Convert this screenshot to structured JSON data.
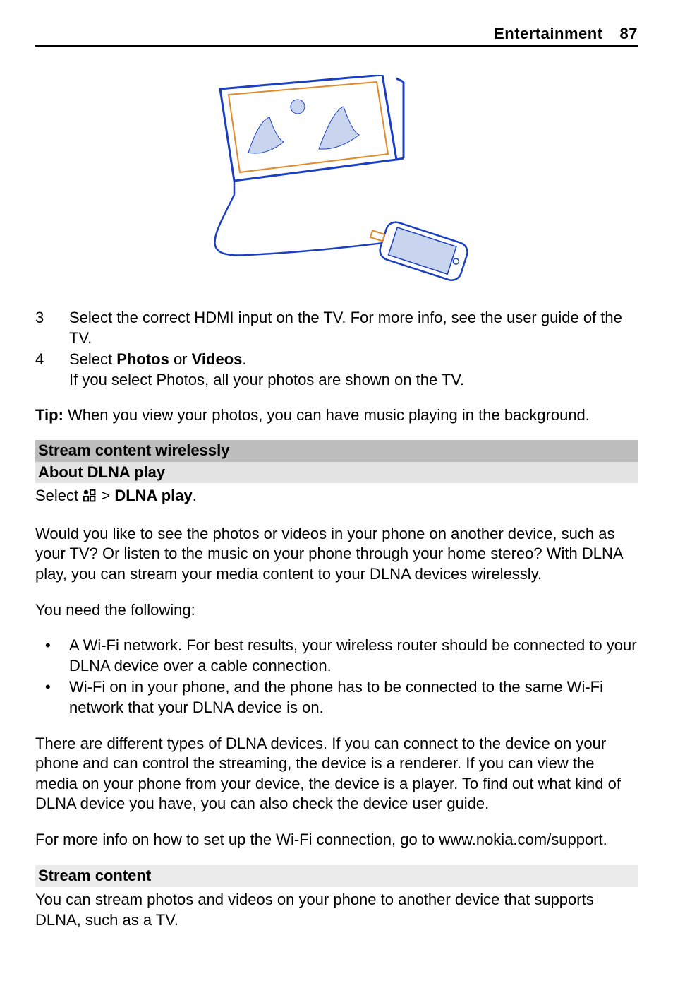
{
  "header": {
    "section": "Entertainment",
    "page": "87"
  },
  "steps": [
    {
      "n": "3",
      "text": "Select the correct HDMI input on the TV. For more info, see the user guide of the TV."
    },
    {
      "n": "4",
      "lead": "Select ",
      "b1": "Photos",
      "mid": " or ",
      "b2": "Videos",
      "tail": ".",
      "sub": "If you select Photos, all your photos are shown on the TV."
    }
  ],
  "tip": {
    "label": "Tip:",
    "text": " When you view your photos, you can have music playing in the background."
  },
  "sec1": {
    "title": "Stream content wirelessly",
    "subtitle": "About DLNA play"
  },
  "select": {
    "lead": "Select ",
    "arrow": " > ",
    "target": "DLNA play",
    "tail": "."
  },
  "p1": "Would you like to see the photos or videos in your phone on another device, such as your TV? Or listen to the music on your phone through your home stereo? With DLNA play, you can stream your media content to your DLNA devices wirelessly.",
  "p2": "You need the following:",
  "bullets": [
    "A Wi-Fi network. For best results, your wireless router should be connected to your DLNA device over a cable connection.",
    "Wi-Fi on in your phone, and the phone has to be connected to the same Wi-Fi network that your DLNA device is on."
  ],
  "p3": "There are different types of DLNA devices. If you can connect to the device on your phone and can control the streaming, the device is a renderer. If you can view the media on your phone from your device, the device is a player. To find out what kind of DLNA device you have, you can also check the device user guide.",
  "p4": "For more info on how to set up the Wi-Fi connection, go to www.nokia.com/support.",
  "sec2": {
    "title": "Stream content"
  },
  "p5": "You can stream photos and videos on your phone to another device that supports DLNA, such as a TV."
}
